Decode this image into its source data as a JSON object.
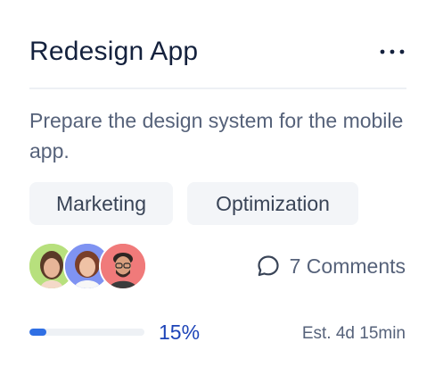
{
  "card": {
    "title": "Redesign App",
    "description": "Prepare the design system for the mobile app.",
    "tags": [
      {
        "label": "Marketing"
      },
      {
        "label": "Optimization"
      }
    ],
    "avatars": [
      {
        "icon": "person-avatar",
        "bg": "#b7e07d"
      },
      {
        "icon": "person-avatar",
        "bg": "#7f93f2"
      },
      {
        "icon": "person-avatar",
        "bg": "#f07a7a"
      }
    ],
    "comments": {
      "label": "7 Comments",
      "icon": "comment-bubble-icon"
    },
    "progress": {
      "value": 0.15,
      "label": "15%"
    },
    "estimate": "Est. 4d 15min"
  },
  "colors": {
    "title": "#14213d",
    "text": "#56627a",
    "accent": "#2f6fe4",
    "accent_text": "#1d44b8",
    "tag_bg": "#f3f5f8"
  }
}
